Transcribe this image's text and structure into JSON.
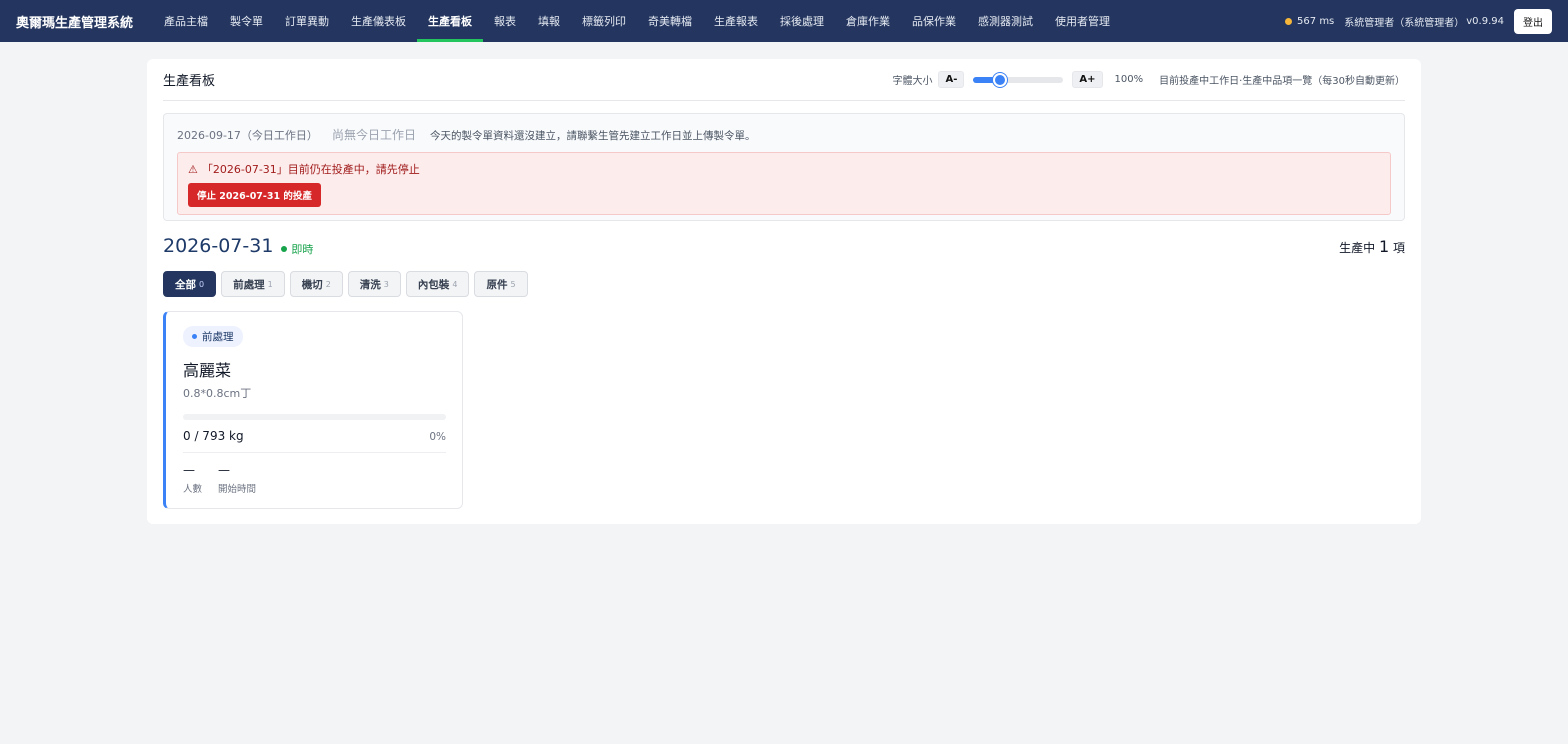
{
  "app": {
    "title": "奧爾瑪生產管理系統"
  },
  "nav": {
    "items": [
      "產品主檔",
      "製令單",
      "訂單異動",
      "生產儀表板",
      "生產看板",
      "報表",
      "填報",
      "標籤列印",
      "奇美轉檔",
      "生產報表",
      "採後處理",
      "倉庫作業",
      "品保作業",
      "感測器測試",
      "使用者管理"
    ],
    "active_index": 4
  },
  "top_right": {
    "latency": "567 ms",
    "user": "系統管理者（系統管理者）",
    "version": "v0.9.94",
    "logout_label": "登出",
    "status_color": "#f5b63a"
  },
  "board": {
    "title": "生產看板",
    "font_size_label": "字體大小",
    "font_minus": "A-",
    "font_plus": "A+",
    "font_percent": "100%",
    "font_slider_fraction": 0.3,
    "subtitle": "目前投產中工作日·生產中品項一覽（每30秒自動更新）"
  },
  "info": {
    "today": "2026-09-17（今日工作日）",
    "no_workday": "尚無今日工作日",
    "message": "今天的製令單資料還沒建立，請聯繫生管先建立工作日並上傳製令單。",
    "alert_text": "「2026-07-31」目前仍在投產中，請先停止",
    "stop_button": "停止 2026-07-31 的投產"
  },
  "production": {
    "date": "2026-07-31",
    "live_label": "即時",
    "count_prefix": "生產中",
    "count_value": "1",
    "count_suffix": "項"
  },
  "filters": [
    {
      "label": "全部",
      "count": "0",
      "active": true
    },
    {
      "label": "前處理",
      "count": "1",
      "active": false
    },
    {
      "label": "機切",
      "count": "2",
      "active": false
    },
    {
      "label": "清洗",
      "count": "3",
      "active": false
    },
    {
      "label": "內包裝",
      "count": "4",
      "active": false
    },
    {
      "label": "原件",
      "count": "5",
      "active": false
    }
  ],
  "card": {
    "stage": "前處理",
    "name": "高麗菜",
    "spec": "0.8*0.8cm丁",
    "qty": "0 / 793 kg",
    "percent": "0%",
    "progress_fraction": 0,
    "workers_value": "—",
    "workers_label": "人數",
    "start_value": "—",
    "start_label": "開始時間",
    "accent_color": "#3b82f6"
  }
}
